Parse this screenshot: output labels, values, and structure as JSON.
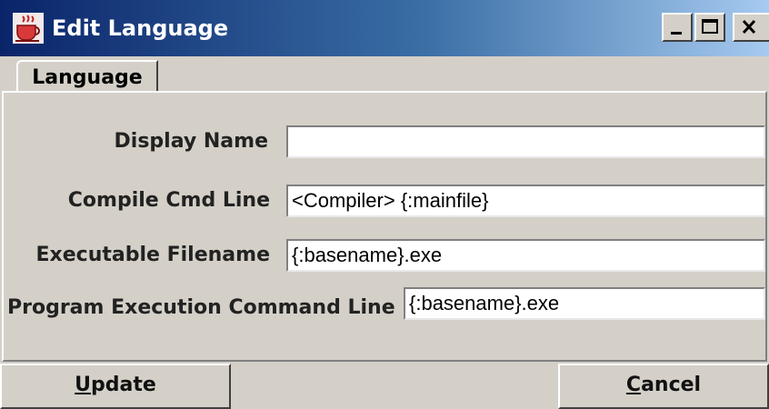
{
  "window": {
    "title": "Edit Language",
    "app_icon": "java-cup-icon",
    "controls": [
      "minimize-icon",
      "maximize-icon",
      "close-icon"
    ]
  },
  "tabs": [
    {
      "label": "Language",
      "selected": true
    }
  ],
  "form": {
    "display_name": {
      "label": "Display Name",
      "value": ""
    },
    "compile_cmd_line": {
      "label": "Compile Cmd Line",
      "value": "<Compiler> {:mainfile}"
    },
    "executable_filename": {
      "label": "Executable Filename",
      "value": "{:basename}.exe"
    },
    "program_execution_command_line": {
      "label": "Program Execution Command Line",
      "value": "{:basename}.exe"
    }
  },
  "buttons": {
    "update": {
      "mnemonic": "U",
      "rest": "pdate"
    },
    "cancel": {
      "mnemonic": "C",
      "rest": "ancel"
    }
  },
  "colors": {
    "titlebar_start": "#0a246a",
    "titlebar_end": "#a6caf0",
    "window_bg": "#d4d0c8"
  }
}
